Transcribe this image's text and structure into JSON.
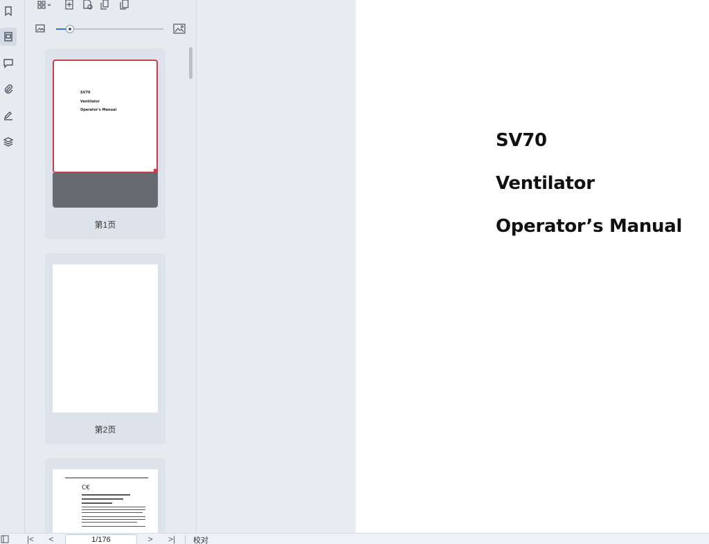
{
  "left_rail": {
    "items": [
      {
        "name": "bookmark-icon"
      },
      {
        "name": "thumbnails-icon"
      },
      {
        "name": "comment-icon"
      },
      {
        "name": "attachment-icon"
      },
      {
        "name": "signature-icon"
      },
      {
        "name": "layers-icon"
      }
    ]
  },
  "thumbnails": {
    "zoom_level": 0.13,
    "pages": [
      {
        "label": "第1页",
        "title_lines": [
          "SV70",
          "Ventilator",
          "Operator's Manual"
        ],
        "selected": true
      },
      {
        "label": "第2页",
        "selected": false
      },
      {
        "label": "",
        "selected": false
      }
    ]
  },
  "document": {
    "title_lines": [
      "SV70",
      "Ventilator",
      "Operator’s Manual"
    ]
  },
  "statusbar": {
    "page_indicator": "1/176",
    "first_page": "|<",
    "prev_page": "<",
    "next_page": ">",
    "last_page": ">|",
    "proofread_label": "校对"
  },
  "colors": {
    "accent": "#3a6fd8",
    "selection": "#cf3a48"
  }
}
